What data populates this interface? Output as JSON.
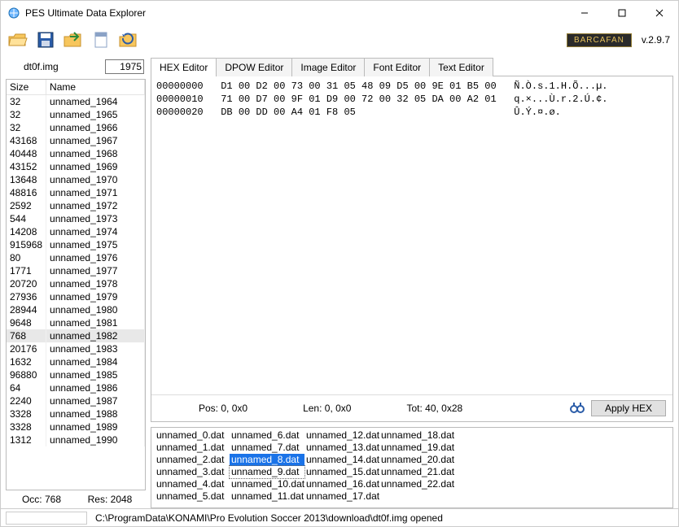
{
  "window": {
    "title": "PES Ultimate Data Explorer"
  },
  "branding": {
    "badge": "BARCAFAN",
    "version": "v.2.9.7"
  },
  "left": {
    "filename": "dt0f.img",
    "count": "1975",
    "headers": {
      "size": "Size",
      "name": "Name"
    },
    "rows": [
      {
        "size": "32",
        "name": "unnamed_1964"
      },
      {
        "size": "32",
        "name": "unnamed_1965"
      },
      {
        "size": "32",
        "name": "unnamed_1966"
      },
      {
        "size": "43168",
        "name": "unnamed_1967"
      },
      {
        "size": "40448",
        "name": "unnamed_1968"
      },
      {
        "size": "43152",
        "name": "unnamed_1969"
      },
      {
        "size": "13648",
        "name": "unnamed_1970"
      },
      {
        "size": "48816",
        "name": "unnamed_1971"
      },
      {
        "size": "2592",
        "name": "unnamed_1972"
      },
      {
        "size": "544",
        "name": "unnamed_1973"
      },
      {
        "size": "14208",
        "name": "unnamed_1974"
      },
      {
        "size": "915968",
        "name": "unnamed_1975"
      },
      {
        "size": "80",
        "name": "unnamed_1976"
      },
      {
        "size": "1771",
        "name": "unnamed_1977"
      },
      {
        "size": "20720",
        "name": "unnamed_1978"
      },
      {
        "size": "27936",
        "name": "unnamed_1979"
      },
      {
        "size": "28944",
        "name": "unnamed_1980"
      },
      {
        "size": "9648",
        "name": "unnamed_1981"
      },
      {
        "size": "768",
        "name": "unnamed_1982"
      },
      {
        "size": "20176",
        "name": "unnamed_1983"
      },
      {
        "size": "1632",
        "name": "unnamed_1984"
      },
      {
        "size": "96880",
        "name": "unnamed_1985"
      },
      {
        "size": "64",
        "name": "unnamed_1986"
      },
      {
        "size": "2240",
        "name": "unnamed_1987"
      },
      {
        "size": "3328",
        "name": "unnamed_1988"
      },
      {
        "size": "3328",
        "name": "unnamed_1989"
      },
      {
        "size": "1312",
        "name": "unnamed_1990"
      }
    ],
    "selected_index": 18,
    "occ_label": "Occ: ",
    "occ_value": "768",
    "res_label": "Res: ",
    "res_value": "2048"
  },
  "tabs": {
    "items": [
      "HEX Editor",
      "DPOW Editor",
      "Image  Editor",
      "Font Editor",
      "Text Editor"
    ],
    "active": 0
  },
  "hex": {
    "lines": [
      {
        "addr": "00000000",
        "bytes": "D1 00 D2 00 73 00 31 05 48 09 D5 00 9E 01 B5 00",
        "ascii": "Ñ.Ò.s.1.H.Õ...µ."
      },
      {
        "addr": "00000010",
        "bytes": "71 00 D7 00 9F 01 D9 00 72 00 32 05 DA 00 A2 01",
        "ascii": "q.×...Ù.r.2.Ú.¢."
      },
      {
        "addr": "00000020",
        "bytes": "DB 00 DD 00 A4 01 F8 05",
        "ascii": "Û.Ý.¤.ø."
      }
    ],
    "pos_label": "Pos: ",
    "pos_value": "0, 0x0",
    "len_label": "Len: ",
    "len_value": "0, 0x0",
    "tot_label": "Tot: ",
    "tot_value": "40, 0x28",
    "apply_label": "Apply HEX"
  },
  "filelist": {
    "items": [
      "unnamed_0.dat",
      "unnamed_1.dat",
      "unnamed_2.dat",
      "unnamed_3.dat",
      "unnamed_4.dat",
      "unnamed_5.dat",
      "unnamed_6.dat",
      "unnamed_7.dat",
      "unnamed_8.dat",
      "unnamed_9.dat",
      "unnamed_10.dat",
      "unnamed_11.dat",
      "unnamed_12.dat",
      "unnamed_13.dat",
      "unnamed_14.dat",
      "unnamed_15.dat",
      "unnamed_16.dat",
      "unnamed_17.dat",
      "unnamed_18.dat",
      "unnamed_19.dat",
      "unnamed_20.dat",
      "unnamed_21.dat",
      "unnamed_22.dat"
    ],
    "selected_index": 8,
    "focus_index": 9
  },
  "status": "C:\\ProgramData\\KONAMI\\Pro Evolution Soccer 2013\\download\\dt0f.img opened",
  "icons": {
    "open": "open-folder-icon",
    "save": "save-icon",
    "import": "import-icon",
    "export": "export-icon",
    "replace": "replace-icon"
  }
}
